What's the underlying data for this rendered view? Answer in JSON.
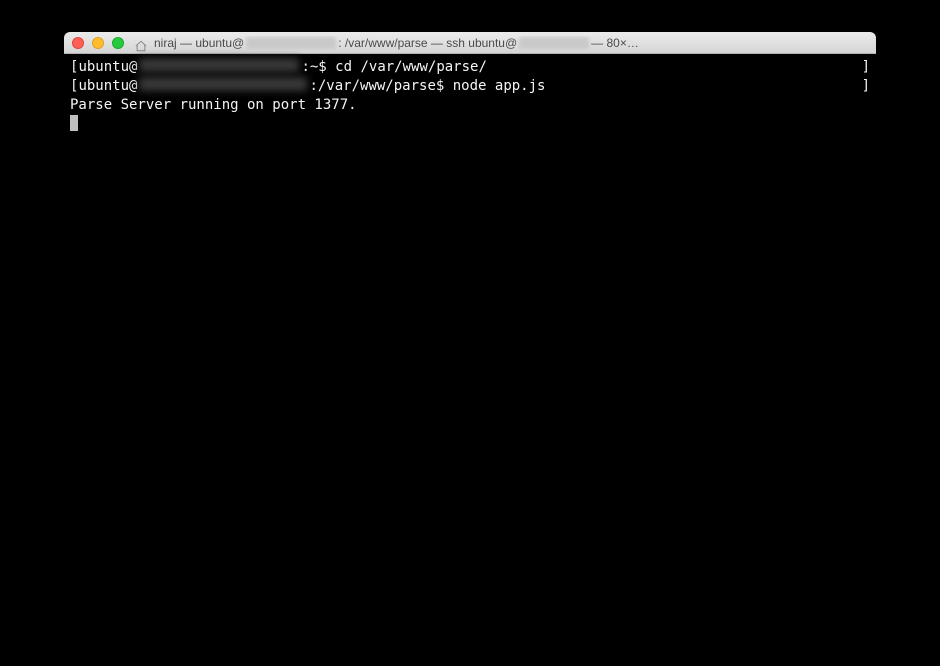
{
  "titlebar": {
    "prefix": "niraj — ubuntu@",
    "middle": ": /var/www/parse — ssh ubuntu@",
    "suffix": " — 80×…"
  },
  "terminal": {
    "line1": {
      "open_bracket": "[",
      "prompt_user": "ubuntu@",
      "prompt_path": ":~$ ",
      "command": "cd /var/www/parse/",
      "close_bracket": "]"
    },
    "line2": {
      "open_bracket": "[",
      "prompt_user": "ubuntu@",
      "prompt_path": ":/var/www/parse$ ",
      "command": "node app.js",
      "close_bracket": "]"
    },
    "line3": {
      "output": "Parse Server running on port 1377."
    }
  }
}
